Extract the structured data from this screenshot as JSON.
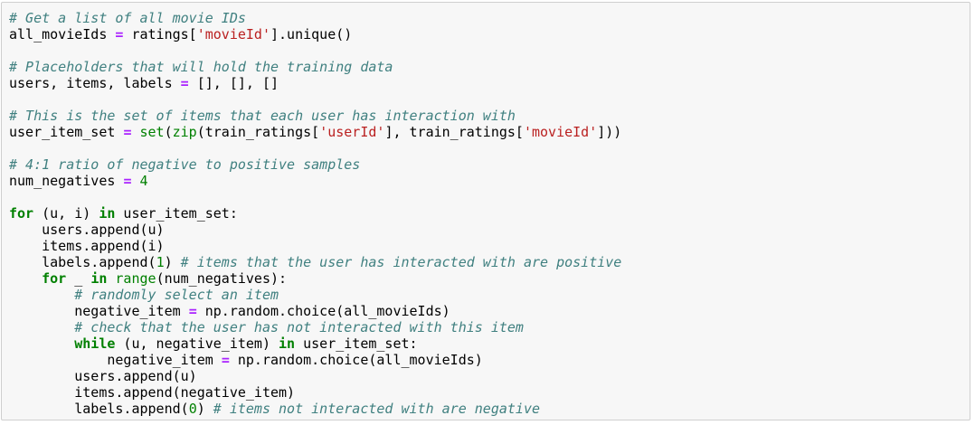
{
  "lines": [
    [
      {
        "c": "cm",
        "t": "# Get a list of all movie IDs"
      }
    ],
    [
      {
        "c": "",
        "t": "all_movieIds "
      },
      {
        "c": "op",
        "t": "="
      },
      {
        "c": "",
        "t": " ratings["
      },
      {
        "c": "st",
        "t": "'movieId'"
      },
      {
        "c": "",
        "t": "].unique()"
      }
    ],
    [],
    [
      {
        "c": "cm",
        "t": "# Placeholders that will hold the training data"
      }
    ],
    [
      {
        "c": "",
        "t": "users, items, labels "
      },
      {
        "c": "op",
        "t": "="
      },
      {
        "c": "",
        "t": " [], [], []"
      }
    ],
    [],
    [
      {
        "c": "cm",
        "t": "# This is the set of items that each user has interaction with"
      }
    ],
    [
      {
        "c": "",
        "t": "user_item_set "
      },
      {
        "c": "op",
        "t": "="
      },
      {
        "c": "",
        "t": " "
      },
      {
        "c": "bi",
        "t": "set"
      },
      {
        "c": "",
        "t": "("
      },
      {
        "c": "bi",
        "t": "zip"
      },
      {
        "c": "",
        "t": "(train_ratings["
      },
      {
        "c": "st",
        "t": "'userId'"
      },
      {
        "c": "",
        "t": "], train_ratings["
      },
      {
        "c": "st",
        "t": "'movieId'"
      },
      {
        "c": "",
        "t": "]))"
      }
    ],
    [],
    [
      {
        "c": "cm",
        "t": "# 4:1 ratio of negative to positive samples"
      }
    ],
    [
      {
        "c": "",
        "t": "num_negatives "
      },
      {
        "c": "op",
        "t": "="
      },
      {
        "c": "",
        "t": " "
      },
      {
        "c": "nm",
        "t": "4"
      }
    ],
    [],
    [
      {
        "c": "kw",
        "t": "for"
      },
      {
        "c": "",
        "t": " (u, i) "
      },
      {
        "c": "kw",
        "t": "in"
      },
      {
        "c": "",
        "t": " user_item_set:"
      }
    ],
    [
      {
        "c": "",
        "t": "    users.append(u)"
      }
    ],
    [
      {
        "c": "",
        "t": "    items.append(i)"
      }
    ],
    [
      {
        "c": "",
        "t": "    labels.append("
      },
      {
        "c": "nm",
        "t": "1"
      },
      {
        "c": "",
        "t": ") "
      },
      {
        "c": "cm",
        "t": "# items that the user has interacted with are positive"
      }
    ],
    [
      {
        "c": "",
        "t": "    "
      },
      {
        "c": "kw",
        "t": "for"
      },
      {
        "c": "",
        "t": " _ "
      },
      {
        "c": "kw",
        "t": "in"
      },
      {
        "c": "",
        "t": " "
      },
      {
        "c": "bi",
        "t": "range"
      },
      {
        "c": "",
        "t": "(num_negatives):"
      }
    ],
    [
      {
        "c": "",
        "t": "        "
      },
      {
        "c": "cm",
        "t": "# randomly select an item"
      }
    ],
    [
      {
        "c": "",
        "t": "        negative_item "
      },
      {
        "c": "op",
        "t": "="
      },
      {
        "c": "",
        "t": " np.random.choice(all_movieIds)"
      }
    ],
    [
      {
        "c": "",
        "t": "        "
      },
      {
        "c": "cm",
        "t": "# check that the user has not interacted with this item"
      }
    ],
    [
      {
        "c": "",
        "t": "        "
      },
      {
        "c": "kw",
        "t": "while"
      },
      {
        "c": "",
        "t": " (u, negative_item) "
      },
      {
        "c": "kw",
        "t": "in"
      },
      {
        "c": "",
        "t": " user_item_set:"
      }
    ],
    [
      {
        "c": "",
        "t": "            negative_item "
      },
      {
        "c": "op",
        "t": "="
      },
      {
        "c": "",
        "t": " np.random.choice(all_movieIds)"
      }
    ],
    [
      {
        "c": "",
        "t": "        users.append(u)"
      }
    ],
    [
      {
        "c": "",
        "t": "        items.append(negative_item)"
      }
    ],
    [
      {
        "c": "",
        "t": "        labels.append("
      },
      {
        "c": "nm",
        "t": "0"
      },
      {
        "c": "",
        "t": ") "
      },
      {
        "c": "cm",
        "t": "# items not interacted with are negative"
      }
    ]
  ]
}
